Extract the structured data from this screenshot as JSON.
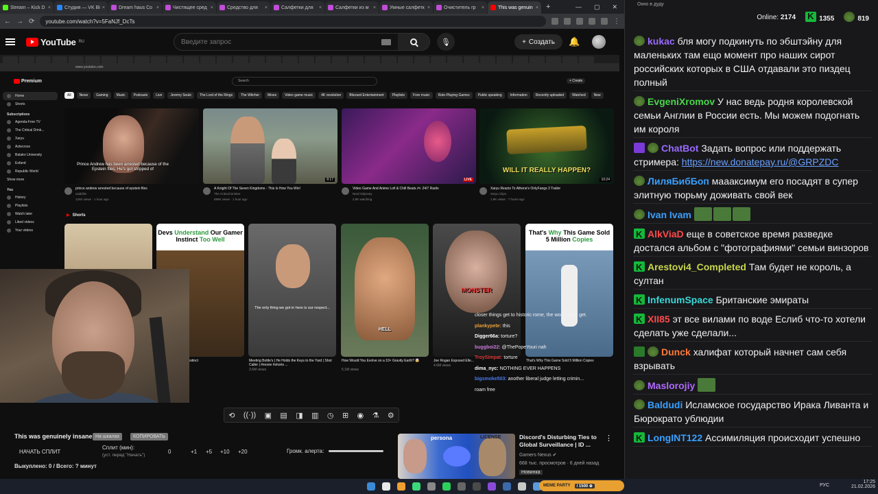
{
  "browser": {
    "tabs": [
      {
        "label": "Stream – Kick D",
        "color": "#53fc18"
      },
      {
        "label": "Студия — VK Ві",
        "color": "#2787f5"
      },
      {
        "label": "Dream haus Co",
        "color": "#c04dd8"
      },
      {
        "label": "Чистящее сред",
        "color": "#c04dd8"
      },
      {
        "label": "Средство для",
        "color": "#c04dd8"
      },
      {
        "label": "Салфетки для",
        "color": "#c04dd8"
      },
      {
        "label": "Салфетки из м",
        "color": "#c04dd8"
      },
      {
        "label": "Умные салфетк",
        "color": "#c04dd8"
      },
      {
        "label": "Очиститель гр",
        "color": "#c04dd8"
      },
      {
        "label": "This was genuin",
        "color": "#ff0000"
      }
    ],
    "url": "youtube.com/watch?v=5FaNJf_DcTs",
    "new_tab": "+",
    "window_controls": [
      "—",
      "▢",
      "✕"
    ]
  },
  "youtube": {
    "logo": "YouTube",
    "region": "RU",
    "search_placeholder": "Введите запрос",
    "create_label": "Создать",
    "create_plus": "+"
  },
  "stream": {
    "inner": {
      "url": "www.youtube.com",
      "logo": "Premium",
      "search_placeholder": "Search",
      "create": "+ Create",
      "chips": [
        "All",
        "News",
        "Gaming",
        "Music",
        "Podcasts",
        "Live",
        "Jeremy Soule",
        "The Lord of the Rings",
        "The Witcher",
        "Mixes",
        "Video game music",
        "4K resolution",
        "Blizzard Entertainment",
        "Playlists",
        "Free music",
        "Role-Playing Games",
        "Public speaking",
        "Information",
        "Recently uploaded",
        "Watched",
        "New"
      ],
      "sidebar": {
        "items": [
          {
            "label": "Home"
          },
          {
            "label": "Shorts"
          }
        ],
        "subs_header": "Subscriptions",
        "subs": [
          "Agenda-Free TV",
          "The Critical Drink...",
          "Xaryu",
          "Aztecross",
          "Balatro University",
          "Esfand",
          "Republic World"
        ],
        "show_more": "Show more",
        "you_header": "You",
        "you_items": [
          "History",
          "Playlists",
          "Watch later",
          "Liked videos",
          "Your videos"
        ]
      },
      "videos": [
        {
          "title": "prince andrew arrested because of epstein files",
          "channel": "vaidzlile",
          "meta": "124K views · 1 hour ago",
          "caption": "Prince Andrew has been arrested because of the Epstein files. He's got stripped of"
        },
        {
          "title": "A Knight Of The Seven Kingdoms - This Is How You Win!",
          "channel": "The Critical Drinker",
          "meta": "699K views · 1 hour ago",
          "duration": "8:17"
        },
        {
          "title": "Video Game And Anime Lofi & Chill Beats 🎮 24/7 Radio",
          "channel": "Nerd Odyssey",
          "meta": "2.9K watching",
          "badge": "LIVE"
        },
        {
          "title": "Xaryu Reacts To Athene's OnlyFangs 3 Trailer",
          "channel": "Xaryu Clips",
          "meta": "1.9K views · 7 hours ago",
          "duration": "10:24",
          "overlay": "WILL IT REALLY HAPPEN?"
        }
      ],
      "shorts_label": "Shorts",
      "shorts": [
        {
          "title": "",
          "meta": ""
        },
        {
          "title": "...stand Our Gamer Instinct",
          "banner_a": "Devs ",
          "banner_b": "Understand",
          "banner_c": " Our Gamer Instinct ",
          "banner_d": "Too Well"
        },
        {
          "title": "Meeting Bottle's | He Holds the Keys to the Yard | Shot Caller | #movie #shorts ...",
          "meta": "3.6M views",
          "subtitle": "The only thing we got in here is our respect..."
        },
        {
          "title": "How Would You Evolve on a 10× Gravity Earth? 🤯",
          "meta": "5.1M views",
          "overlay": "HELL"
        },
        {
          "title": "Joe Rogan Exposed Elle...",
          "meta": "4.6M views",
          "overlay": "MONSTER"
        },
        {
          "title": "That's Why This Game Sold 5 Million Copies",
          "banner_a": "That's ",
          "banner_b": "Why",
          "banner_c": " This Game Sold 5 Million ",
          "banner_d": "Copies"
        }
      ]
    },
    "chat_overlay": [
      {
        "user": "",
        "text": "closer things get to historic rome, the worse they get.",
        "color": "#ffffff"
      },
      {
        "user": "plankypete:",
        "text": "this",
        "color": "#e8a03a"
      },
      {
        "user": "Digger66a:",
        "text": "torture?",
        "color": "#ffffff"
      },
      {
        "user": "buggboi22:",
        "text": "@ThePopeYouri nah",
        "color": "#c87ad8"
      },
      {
        "user": "TroySimpat:",
        "text": "torture",
        "color": "#e03a3a"
      },
      {
        "user": "dima_nyc:",
        "text": "NOTHING EVER HAPPENS",
        "color": "#ffffff"
      },
      {
        "user": "bigsmoke503:",
        "text": "another liberal judge letting crimin...",
        "color": "#4a7ae8"
      },
      {
        "user": "",
        "text": "roam free",
        "color": "#ffffff"
      }
    ]
  },
  "player": {
    "controls": [
      "⟲",
      "((·))",
      "▣",
      "▤",
      "◨",
      "▥",
      "◷",
      "⊞",
      "◉",
      "⚗",
      "⚙"
    ],
    "title": "This was genuinely insane...",
    "pill_a": "На шкалах",
    "pill_b": "КОПИРОВАТЬ",
    "split_button": "НАЧАТЬ СПЛИТ",
    "split_label": "Сплит (мин):",
    "split_hint": "(уст. перед \"Начать\")",
    "split_value": "0",
    "increments": [
      "+1",
      "+5",
      "+10",
      "+20"
    ],
    "alert_volume": "Громк. алерта:",
    "bought": "Выкуплено: 0 / Всего: ? минут"
  },
  "recommendation": {
    "title": "Discord's Disturbing Ties to Global Surveillance | ID ...",
    "channel": "Gamers Nexus",
    "meta": "668 тыс. просмотров · 6 дней назад",
    "badge": "Новинка",
    "thumb_text": "persona",
    "thumb_text2": "LICENSE",
    "more": "⋮"
  },
  "chat": {
    "window_title": "Окно в дуду",
    "online_label": "Online:",
    "online_value": "2174",
    "stat_a": "1355",
    "stat_b": "819",
    "messages": [
      {
        "badges": [
          "pepe"
        ],
        "user": "kukac",
        "color": "#9a6aff",
        "text": "бля могу подкинуть по эбштэйну для маленьких там ещо момент про наших сирот российских которых в США отдавали это пиздец полный"
      },
      {
        "badges": [
          "pepe"
        ],
        "user": "EvgeniXromov",
        "color": "#4ad84a",
        "text": "У нас ведь родня королевской семьи Англии в России есть. Мы можем подогнать им короля"
      },
      {
        "badges": [
          "purple",
          "pepe"
        ],
        "user": "ChatBot",
        "color": "#9a6aff",
        "text": "Задать вопрос или поддержать стримера: ",
        "link": "https://new.donatepay.ru/@GRPZDC"
      },
      {
        "badges": [
          "pepe"
        ],
        "user": "ЛиляБибБоп",
        "color": "#3aa0ff",
        "text": "мааaксимум его посадят в супер элитную тюрьму доживать свой век"
      },
      {
        "badges": [
          "pepe"
        ],
        "user": "Ivan Ivam",
        "color": "#3aa0ff",
        "text": "",
        "emotes": 3
      },
      {
        "badges": [
          "k"
        ],
        "user": "AlkViaD",
        "color": "#ff4a4a",
        "text": "еще в советское время разведке достался альбом с \"фотографиями\" семьи винзоров"
      },
      {
        "badges": [
          "k"
        ],
        "user": "Arestovi4_Completed",
        "color": "#c8d84a",
        "text": "Там будет не король, а султан"
      },
      {
        "badges": [
          "k"
        ],
        "user": "InfenumSpace",
        "color": "#3ad8d8",
        "text": "Британские эмираты"
      },
      {
        "badges": [
          "k"
        ],
        "user": "XII85",
        "color": "#ff4a4a",
        "text": "эт все вилами по воде Еслиб что-то хотели сделать уже сделали..."
      },
      {
        "badges": [
          "check",
          "pepe"
        ],
        "user": "Dunck",
        "color": "#ff7a3a",
        "text": "халифат который начнет сам себя взрывать"
      },
      {
        "badges": [
          "pepe"
        ],
        "user": "Maslorojiy",
        "color": "#b06aff",
        "text": "",
        "emotes": 1
      },
      {
        "badges": [
          "pepe"
        ],
        "user": "Baldudi",
        "color": "#3aa0ff",
        "text": "Исламское государство Ирака Ливанта и Бюрократо ублюдии"
      },
      {
        "badges": [
          "k"
        ],
        "user": "LongINT122",
        "color": "#3aa0ff",
        "text": "Ассимиляция происходит успешно"
      }
    ]
  },
  "taskbar": {
    "tray_lang": "РУС",
    "time": "17:25",
    "date": "21.02.2026",
    "widget": "MEME PARTY",
    "widget_value": "/ 1500 ⊕"
  }
}
